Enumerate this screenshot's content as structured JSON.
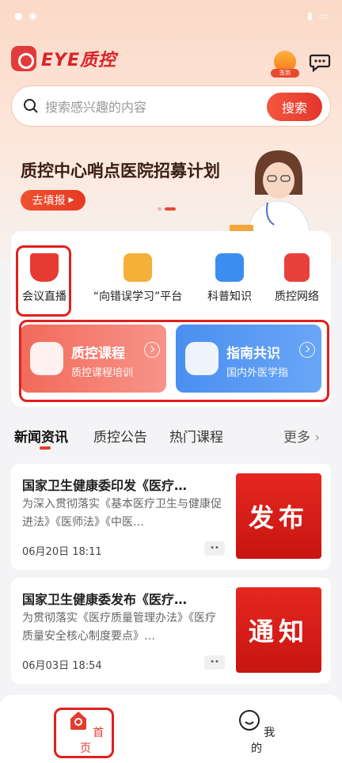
{
  "brand": {
    "name": "EYE质控",
    "logo_color": "#e33b3b"
  },
  "header": {
    "checkin_label": "签到",
    "message_icon": "message-icon"
  },
  "search": {
    "placeholder": "搜索感兴趣的内容",
    "button": "搜索"
  },
  "banner": {
    "title": "质控中心哨点医院招募计划",
    "button": "去填报"
  },
  "quick_links": [
    {
      "label": "会议直播",
      "icon": "live-icon",
      "color": "#e53b33"
    },
    {
      "label": "“向错误学习”平台",
      "icon": "learn-icon",
      "color": "#f5b03a"
    },
    {
      "label": "科普知识",
      "icon": "science-icon",
      "color": "#3b8ef0"
    },
    {
      "label": "质控网络",
      "icon": "network-icon",
      "color": "#e8403a"
    }
  ],
  "courses": [
    {
      "title": "质控课程",
      "subtitle": "质控课程培训",
      "color": "#f26a5a"
    },
    {
      "title": "指南共识",
      "subtitle": "国内外医学指",
      "color": "#4a90f0"
    }
  ],
  "tabs": [
    "新闻资讯",
    "质控公告",
    "热门课程"
  ],
  "more": "更多",
  "news": [
    {
      "title": "国家卫生健康委印发《医疗…",
      "summary": "为深入贯彻落实《基本医疗卫生与健康促进法》《医师法》《中医…",
      "date": "06月20日 18:11",
      "image_text": "发布"
    },
    {
      "title": "国家卫生健康委发布《医疗…",
      "summary": "为贯彻落实《医疗质量管理办法》《医疗质量安全核心制度要点》…",
      "date": "06月03日 18:54",
      "image_text": "通知"
    }
  ],
  "bottom_nav": [
    {
      "label": "首页",
      "icon": "home-icon",
      "active": true
    },
    {
      "label": "我的",
      "icon": "profile-icon",
      "active": false
    }
  ],
  "colors": {
    "accent": "#e33b2f",
    "highlight_border": "#e0201f"
  }
}
